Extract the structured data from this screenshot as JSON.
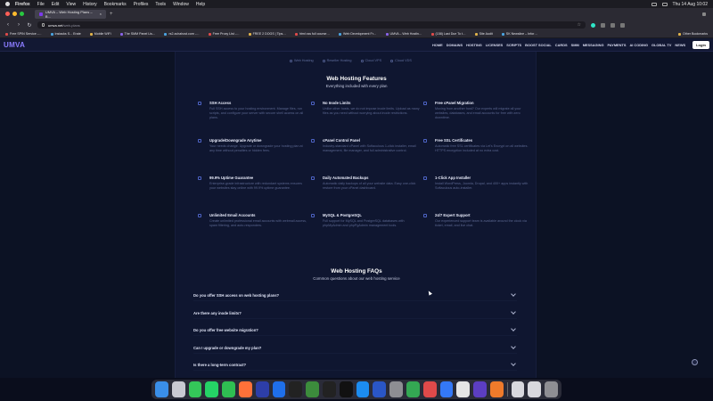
{
  "menubar": {
    "items": [
      "Firefox",
      "File",
      "Edit",
      "View",
      "History",
      "Bookmarks",
      "Profiles",
      "Tools",
      "Window",
      "Help"
    ],
    "clock": "Thu 14 Aug  10:02"
  },
  "browser": {
    "tab_title": "UMVA – Web Hosting Plans – B…",
    "url_host": "umva.net",
    "url_path": "/web-plans",
    "bookmarks": [
      "Free SPIN Service -…",
      "Instacks S... Erate",
      "Mobile WiFi",
      "The SMM Panel Lis…",
      "rs2.zuhahost.com -…",
      "Free Proxy List -…",
      "FREE 2 DOGS | Tips…",
      "html css full course…",
      "Web Development Fr…",
      "UMVA – Web Hostin…",
      "(158) Last Due To t…",
      "Site Audit",
      "SK Newsline – Infor…"
    ],
    "other_bookmarks": "Other Bookmarks"
  },
  "site": {
    "logo": "UMVA",
    "nav": [
      "HOME",
      "DOMAINS",
      "HOSTING",
      "LICENSES",
      "SCRIPTS",
      "BOOST SOCIAL",
      "CARDS",
      "SMM",
      "MESSAGING",
      "PAYMENTS",
      "AI CODING",
      "GLOBAL TV",
      "NEWS"
    ],
    "login": "Login",
    "subtabs": [
      "Web Hosting",
      "Reseller Hosting",
      "Cloud VPS",
      "Cloud VDS"
    ]
  },
  "features_section": {
    "title": "Web Hosting Features",
    "subtitle": "Everything included with every plan",
    "items": [
      {
        "title": "SSH Access",
        "desc": "Full SSH access to your hosting environment. Manage files, run scripts, and configure your server with secure shell access on all plans.",
        "icon": "terminal-icon"
      },
      {
        "title": "No Inode Limits",
        "desc": "Unlike other hosts, we do not impose inode limits. Upload as many files as you need without worrying about inode restrictions.",
        "icon": "infinity-icon"
      },
      {
        "title": "Free cPanel Migration",
        "desc": "Moving from another host? Our experts will migrate all your websites, databases, and email accounts for free with zero downtime.",
        "icon": "transfer-icon"
      },
      {
        "title": "Upgrade/Downgrade Anytime",
        "desc": "Your needs change. Upgrade or downgrade your hosting plan at any time without penalties or hidden fees.",
        "icon": "arrows-icon"
      },
      {
        "title": "cPanel Control Panel",
        "desc": "Industry-standard cPanel with Softaculous 1-click installer, email management, file manager, and full administrative control.",
        "icon": "panel-icon"
      },
      {
        "title": "Free SSL Certificates",
        "desc": "Automatic free SSL certificates via Let's Encrypt on all websites. HTTPS encryption included at no extra cost.",
        "icon": "lock-icon"
      },
      {
        "title": "99.9% Uptime Guarantee",
        "desc": "Enterprise-grade infrastructure with redundant systems ensures your websites stay online with 99.9% uptime guarantee.",
        "icon": "server-icon"
      },
      {
        "title": "Daily Automated Backups",
        "desc": "Automatic daily backups of all your website data. Easy one-click restore from your cPanel dashboard.",
        "icon": "backup-icon"
      },
      {
        "title": "1-Click App Installer",
        "desc": "Install WordPress, Joomla, Drupal, and 400+ apps instantly with Softaculous auto-installer.",
        "icon": "download-icon"
      },
      {
        "title": "Unlimited Email Accounts",
        "desc": "Create unlimited professional email accounts with webmail access, spam filtering, and auto-responders.",
        "icon": "mail-icon"
      },
      {
        "title": "MySQL & PostgreSQL",
        "desc": "Full support for MySQL and PostgreSQL databases with phpMyAdmin and phpPgAdmin management tools.",
        "icon": "database-icon"
      },
      {
        "title": "24/7 Expert Support",
        "desc": "Our experienced support team is available around the clock via ticket, email, and live chat.",
        "icon": "headset-icon"
      }
    ]
  },
  "faq_section": {
    "title": "Web Hosting FAQs",
    "subtitle": "Common questions about our web hosting service",
    "items": [
      "Do you offer SSH access on web hosting plans?",
      "Are there any inode limits?",
      "Do you offer free website migration?",
      "Can I upgrade or downgrade my plan?",
      "Is there a long-term contract?"
    ]
  },
  "colors": {
    "accent": "#8b7cff",
    "background": "#0c1224",
    "panel": "#0f1630"
  }
}
